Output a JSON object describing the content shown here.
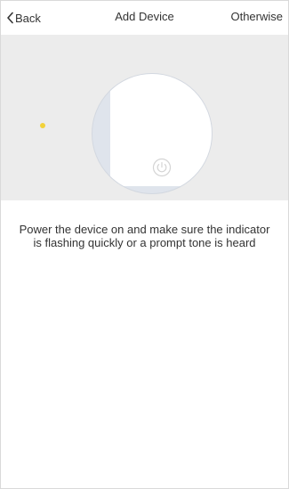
{
  "nav": {
    "back_label": "Back",
    "title": "Add Device",
    "right_label": "Otherwise"
  },
  "hero": {
    "indicator_color": "#f2d23a",
    "icons": [
      "chevron-left-icon",
      "power-icon"
    ]
  },
  "instruction": {
    "text": "Power the device on and make sure the indicator is flashing quickly or a prompt tone is heard"
  }
}
